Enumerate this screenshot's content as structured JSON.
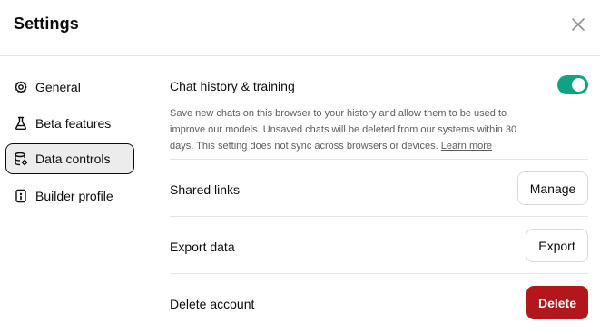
{
  "dialog": {
    "title": "Settings",
    "close_icon": "close-icon"
  },
  "sidebar": {
    "items": [
      {
        "label": "General",
        "icon": "gear-icon",
        "active": false
      },
      {
        "label": "Beta features",
        "icon": "flask-icon",
        "active": false
      },
      {
        "label": "Data controls",
        "icon": "database-icon",
        "active": true
      },
      {
        "label": "Builder profile",
        "icon": "id-card-icon",
        "active": false
      }
    ]
  },
  "main": {
    "chat_history": {
      "label": "Chat history & training",
      "enabled": true,
      "description": "Save new chats on this browser to your history and allow them to be used to improve our models. Unsaved chats will be deleted from our systems within 30 days. This setting does not sync across browsers or devices.",
      "learn_more": "Learn more"
    },
    "shared_links": {
      "label": "Shared links",
      "button": "Manage"
    },
    "export_data": {
      "label": "Export data",
      "button": "Export"
    },
    "delete_account": {
      "label": "Delete account",
      "button": "Delete"
    }
  },
  "colors": {
    "toggle_on": "#10a37f",
    "danger": "#b3171c",
    "active_nav_bg": "#ececec"
  }
}
